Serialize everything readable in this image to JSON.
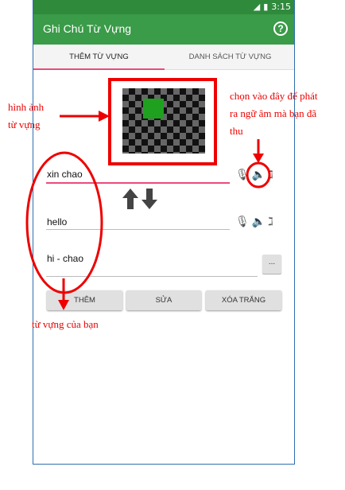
{
  "status": {
    "time": "3:15"
  },
  "app": {
    "title": "Ghi Chú Từ Vựng",
    "help_glyph": "?"
  },
  "tabs": [
    {
      "label": "THÊM TỪ VỰNG"
    },
    {
      "label": "DANH SÁCH TỪ VỰNG"
    }
  ],
  "fields": {
    "word1": "xin chao",
    "word2": "hello",
    "pronunciation": "hi - chao"
  },
  "buttons": {
    "add": "THÊM",
    "edit": "SỬA",
    "clear": "XÓA TRẮNG",
    "more": "..."
  },
  "annotations": {
    "image_line1": "hình ảnh",
    "image_line2": "từ vựng",
    "audio_line1": "chọn vào đây để phát",
    "audio_line2": "ra ngữ âm mà bạn đã",
    "audio_line3": "thu",
    "words": "từ vựng của bạn"
  },
  "colors": {
    "appbar": "#3a9b48",
    "statusbar": "#2f8a3c",
    "accent": "#e94c7a",
    "annotation": "#e00000"
  },
  "icons": [
    "mic-icon",
    "speaker-icon",
    "ear-icon",
    "arrow-up-icon",
    "arrow-down-icon",
    "help-icon"
  ]
}
